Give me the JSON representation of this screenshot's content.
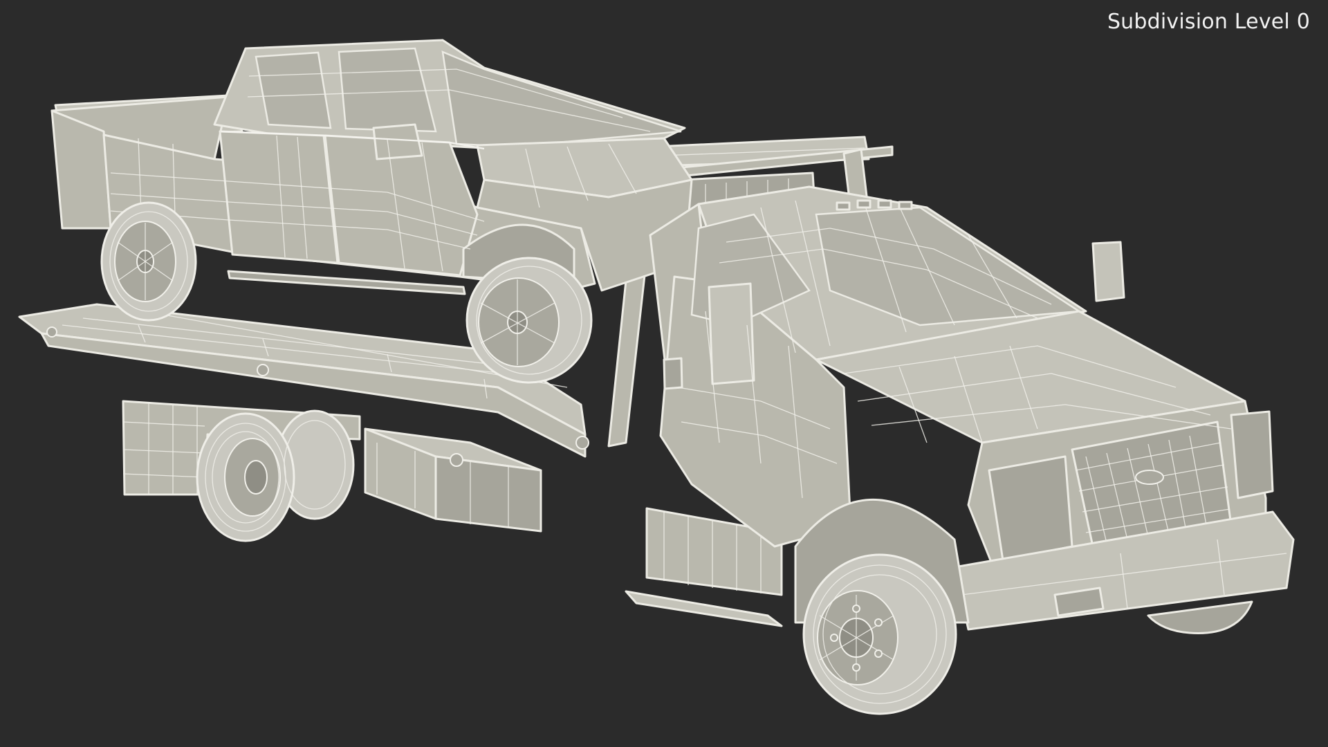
{
  "viewport": {
    "background_color": "#2b2b2b",
    "overlay_label": "Subdivision Level 0"
  },
  "scene": {
    "mesh_fill_color": "#b9b8ad",
    "wire_color": "#f1f0ea"
  }
}
